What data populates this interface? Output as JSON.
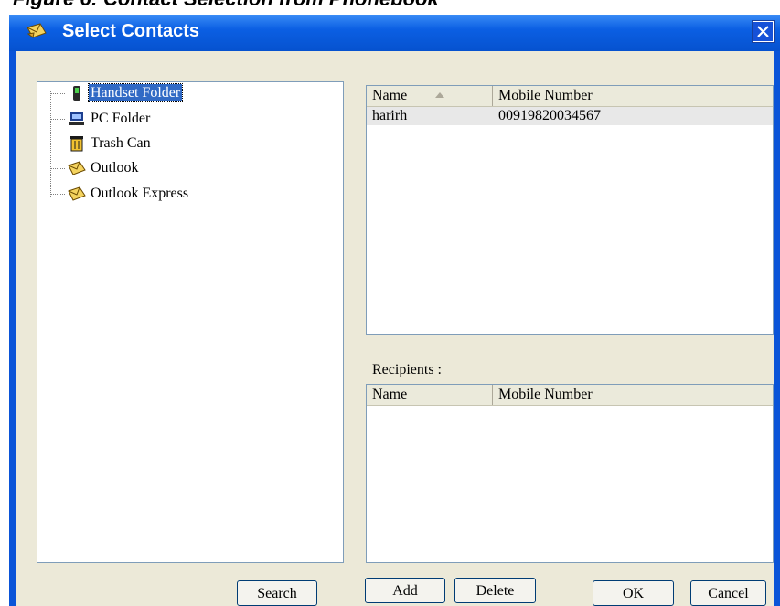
{
  "page_heading": "Figure 6: Contact Selection from Phonebook",
  "window": {
    "title": "Select Contacts",
    "close_icon": "close-x-icon"
  },
  "tree": {
    "items": [
      {
        "label": "Handset Folder",
        "icon": "phone-icon",
        "selected": true
      },
      {
        "label": "PC Folder",
        "icon": "computer-icon",
        "selected": false
      },
      {
        "label": "Trash Can",
        "icon": "trash-icon",
        "selected": false
      },
      {
        "label": "Outlook",
        "icon": "envelope-icon",
        "selected": false
      },
      {
        "label": "Outlook Express",
        "icon": "envelope-icon",
        "selected": false
      }
    ]
  },
  "contacts_list": {
    "columns": [
      "Name",
      "Mobile Number"
    ],
    "sort_column": "Name",
    "rows": [
      {
        "name": "harirh",
        "mobile": "00919820034567"
      }
    ]
  },
  "recipients": {
    "label": "Recipients :",
    "columns": [
      "Name",
      "Mobile Number"
    ],
    "rows": []
  },
  "buttons": {
    "search": "Search",
    "add": "Add",
    "delete": "Delete",
    "ok": "OK",
    "cancel": "Cancel"
  },
  "colors": {
    "titlebar": "#0b5fe3",
    "dialog_bg": "#ece9d8",
    "selection": "#316ac5"
  }
}
